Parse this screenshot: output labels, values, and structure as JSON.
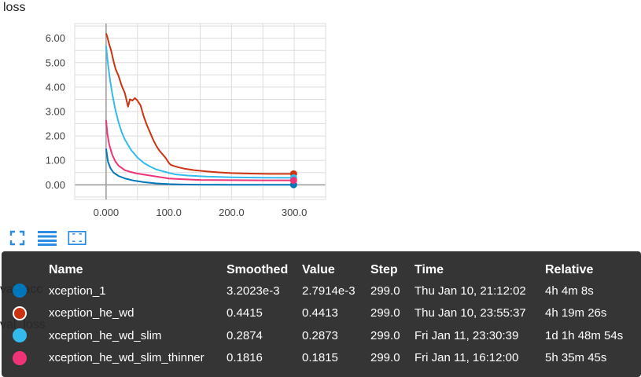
{
  "card": {
    "title": "loss"
  },
  "behind_labels": {
    "val_acc": "val_acc",
    "val_loss": "val_loss"
  },
  "chart_data": {
    "type": "line",
    "title": "",
    "xlabel": "",
    "ylabel": "",
    "xlim": [
      -50,
      350
    ],
    "ylim": [
      -0.6,
      6.6
    ],
    "x_ticks": [
      "0.000",
      "100.0",
      "200.0",
      "300.0"
    ],
    "y_ticks": [
      "0.00",
      "1.00",
      "2.00",
      "3.00",
      "4.00",
      "5.00",
      "6.00"
    ],
    "grid": true,
    "series": [
      {
        "name": "xception_1",
        "color": "#0077bb",
        "x": [
          0,
          3,
          7,
          12,
          20,
          30,
          45,
          60,
          80,
          100,
          120,
          150,
          200,
          250,
          299
        ],
        "y": [
          1.48,
          0.95,
          0.68,
          0.5,
          0.36,
          0.26,
          0.17,
          0.11,
          0.06,
          0.03,
          0.015,
          0.008,
          0.004,
          0.003,
          0.003
        ]
      },
      {
        "name": "xception_he_wd",
        "color": "#cc3311",
        "x": [
          0,
          2,
          5,
          8,
          12,
          15,
          20,
          25,
          30,
          35,
          38,
          42,
          46,
          50,
          55,
          60,
          65,
          70,
          75,
          80,
          85,
          90,
          95,
          100,
          103,
          107,
          115,
          125,
          140,
          160,
          180,
          200,
          230,
          260,
          299
        ],
        "y": [
          6.2,
          6.05,
          5.75,
          5.5,
          5.05,
          4.75,
          4.45,
          4.05,
          3.75,
          3.2,
          3.5,
          3.45,
          3.55,
          3.45,
          3.25,
          2.8,
          2.45,
          2.15,
          1.85,
          1.6,
          1.4,
          1.25,
          1.1,
          0.9,
          0.82,
          0.78,
          0.72,
          0.66,
          0.6,
          0.55,
          0.51,
          0.48,
          0.46,
          0.45,
          0.45
        ]
      },
      {
        "name": "xception_he_wd_slim",
        "color": "#33bbee",
        "x": [
          0,
          3,
          6,
          10,
          15,
          20,
          25,
          30,
          40,
          50,
          60,
          70,
          80,
          90,
          100,
          110,
          130,
          160,
          200,
          250,
          299
        ],
        "y": [
          5.68,
          4.95,
          4.35,
          3.7,
          3.05,
          2.55,
          2.15,
          1.85,
          1.42,
          1.12,
          0.9,
          0.75,
          0.63,
          0.56,
          0.49,
          0.43,
          0.38,
          0.34,
          0.31,
          0.29,
          0.287
        ]
      },
      {
        "name": "xception_he_wd_slim_thinner",
        "color": "#ee3377",
        "x": [
          0,
          2,
          5,
          10,
          15,
          20,
          30,
          40,
          50,
          60,
          70,
          80,
          90,
          100,
          120,
          150,
          200,
          250,
          299
        ],
        "y": [
          2.65,
          2.1,
          1.65,
          1.22,
          0.95,
          0.78,
          0.6,
          0.52,
          0.46,
          0.42,
          0.38,
          0.34,
          0.3,
          0.26,
          0.23,
          0.2,
          0.19,
          0.185,
          0.182
        ]
      }
    ]
  },
  "tooltip": {
    "headers": {
      "name": "Name",
      "smoothed": "Smoothed",
      "value": "Value",
      "step": "Step",
      "time": "Time",
      "relative": "Relative"
    },
    "rows": [
      {
        "name": "xception_1",
        "color": "#0077bb",
        "smoothed": "3.2023e-3",
        "value": "2.7914e-3",
        "step": "299.0",
        "time": "Thu Jan 10, 21:12:02",
        "relative": "4h 4m 8s"
      },
      {
        "name": "xception_he_wd",
        "color": "#cc3311",
        "smoothed": "0.4415",
        "value": "0.4413",
        "step": "299.0",
        "time": "Thu Jan 10, 23:55:37",
        "relative": "4h 19m 26s"
      },
      {
        "name": "xception_he_wd_slim",
        "color": "#33bbee",
        "smoothed": "0.2874",
        "value": "0.2873",
        "step": "299.0",
        "time": "Fri Jan 11, 23:30:39",
        "relative": "1d 1h 48m 54s"
      },
      {
        "name": "xception_he_wd_slim_thinner",
        "color": "#ee3377",
        "smoothed": "0.1816",
        "value": "0.1815",
        "step": "299.0",
        "time": "Fri Jan 11, 16:12:00",
        "relative": "5h 35m 45s"
      }
    ]
  },
  "icons": [
    "fit-screen-icon",
    "toggle-lines-icon",
    "fit-domain-icon"
  ]
}
